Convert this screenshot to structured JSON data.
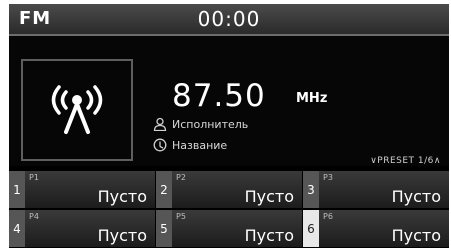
{
  "status": {
    "band": "FM",
    "time": "00:00"
  },
  "station": {
    "frequency": "87.50",
    "unit": "MHz",
    "artist": "Исполнитель",
    "title": "Название",
    "art_icon": "radio-tower-icon"
  },
  "preset_page": "∨PRESET 1/6∧",
  "presets": [
    {
      "num": "1",
      "label": "P1",
      "name": "Пусто",
      "active": false
    },
    {
      "num": "2",
      "label": "P2",
      "name": "Пусто",
      "active": false
    },
    {
      "num": "3",
      "label": "P3",
      "name": "Пусто",
      "active": false
    },
    {
      "num": "4",
      "label": "P4",
      "name": "Пусто",
      "active": false
    },
    {
      "num": "5",
      "label": "P5",
      "name": "Пусто",
      "active": false
    },
    {
      "num": "6",
      "label": "P6",
      "name": "Пусто",
      "active": true
    }
  ]
}
